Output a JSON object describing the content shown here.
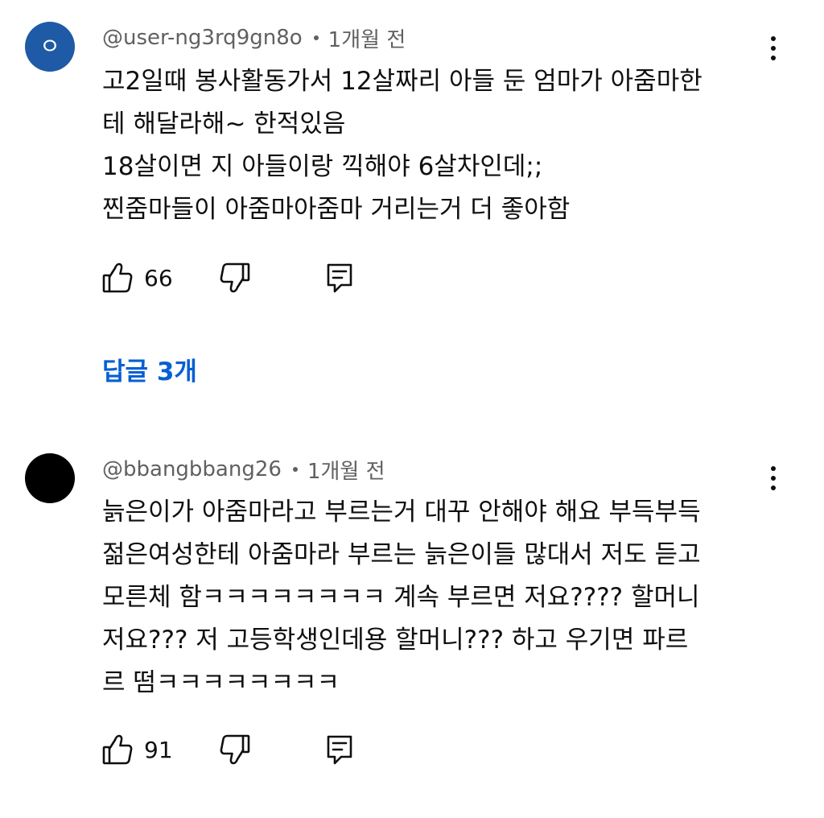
{
  "comments": [
    {
      "avatar_letter": "ㅇ",
      "avatar_color": "#1f5aa6",
      "author": "@user-ng3rq9gn8o",
      "time": "1개월 전",
      "text": "고2일때 봉사활동가서 12살짜리 아들 둔 엄마가 아줌마한\n테 해달라해~ 한적있음\n18살이면 지 아들이랑 끽해야 6살차인데;;\n찐줌마들이 아줌마아줌마 거리는거 더 좋아함",
      "likes": "66",
      "replies_label": "답글 3개"
    },
    {
      "avatar_letter": "",
      "avatar_color": "#000000",
      "author": "@bbangbbang26",
      "time": "1개월 전",
      "text": "늙은이가 아줌마라고 부르는거 대꾸 안해야 해요 부득부득\n젊은여성한테 아줌마라 부르는 늙은이들 많대서 저도 듣고\n모른체 함ㅋㅋㅋㅋㅋㅋㅋㅋ 계속 부르면 저요???? 할머니\n저요??? 저 고등학생인데용 할머니??? 하고 우기면 파르\n르 떰ㅋㅋㅋㅋㅋㅋㅋㅋ",
      "likes": "91"
    }
  ],
  "icons": {
    "like": "thumbs-up-icon",
    "dislike": "thumbs-down-icon",
    "reply": "reply-comment-icon",
    "more": "more-vertical-icon"
  },
  "colors": {
    "link_blue": "#065fd4",
    "meta_gray": "#606060",
    "text": "#0f0f0f"
  }
}
